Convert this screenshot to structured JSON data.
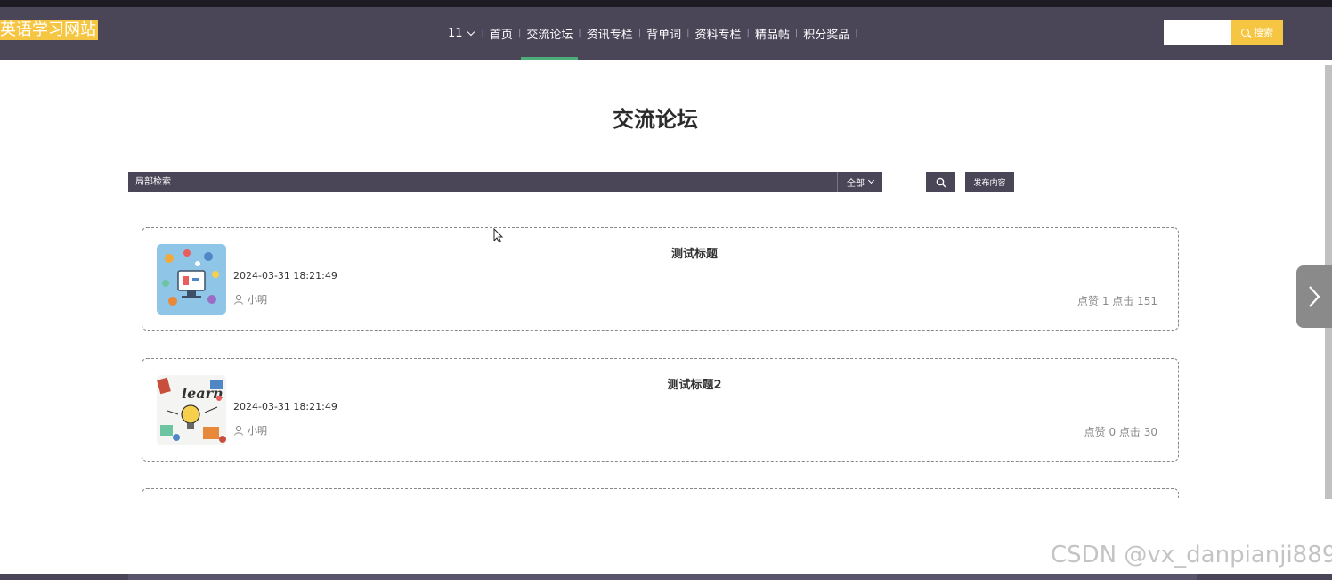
{
  "header": {
    "logo": "英语学习网站",
    "user_menu": "11",
    "nav": [
      {
        "label": "首页",
        "active": false
      },
      {
        "label": "交流论坛",
        "active": true
      },
      {
        "label": "资讯专栏",
        "active": false
      },
      {
        "label": "背单词",
        "active": false
      },
      {
        "label": "资料专栏",
        "active": false
      },
      {
        "label": "精品帖",
        "active": false
      },
      {
        "label": "积分奖品",
        "active": false
      }
    ],
    "search": {
      "value": "",
      "button_label": "搜索"
    }
  },
  "page": {
    "title": "交流论坛",
    "filter": {
      "placeholder": "局部检索",
      "select_label": "全部"
    },
    "publish_label": "发布内容"
  },
  "posts": [
    {
      "title": "测试标题",
      "time": "2024-03-31 18:21:49",
      "author": "小明",
      "stats": "点赞 1 点击 151"
    },
    {
      "title": "测试标题2",
      "time": "2024-03-31 18:21:49",
      "author": "小明",
      "stats": "点赞 0 点击 30"
    },
    {
      "title": "",
      "time": "",
      "author": "",
      "stats": ""
    }
  ],
  "watermark": "CSDN @vx_danpianji889",
  "colors": {
    "header_bg": "#4b4558",
    "accent_yellow": "#f6c643",
    "active_underline": "#4caf7a"
  },
  "icons": [
    "chevron-down-icon",
    "search-icon",
    "user-icon",
    "chevron-right-icon",
    "mouse-cursor-icon"
  ]
}
